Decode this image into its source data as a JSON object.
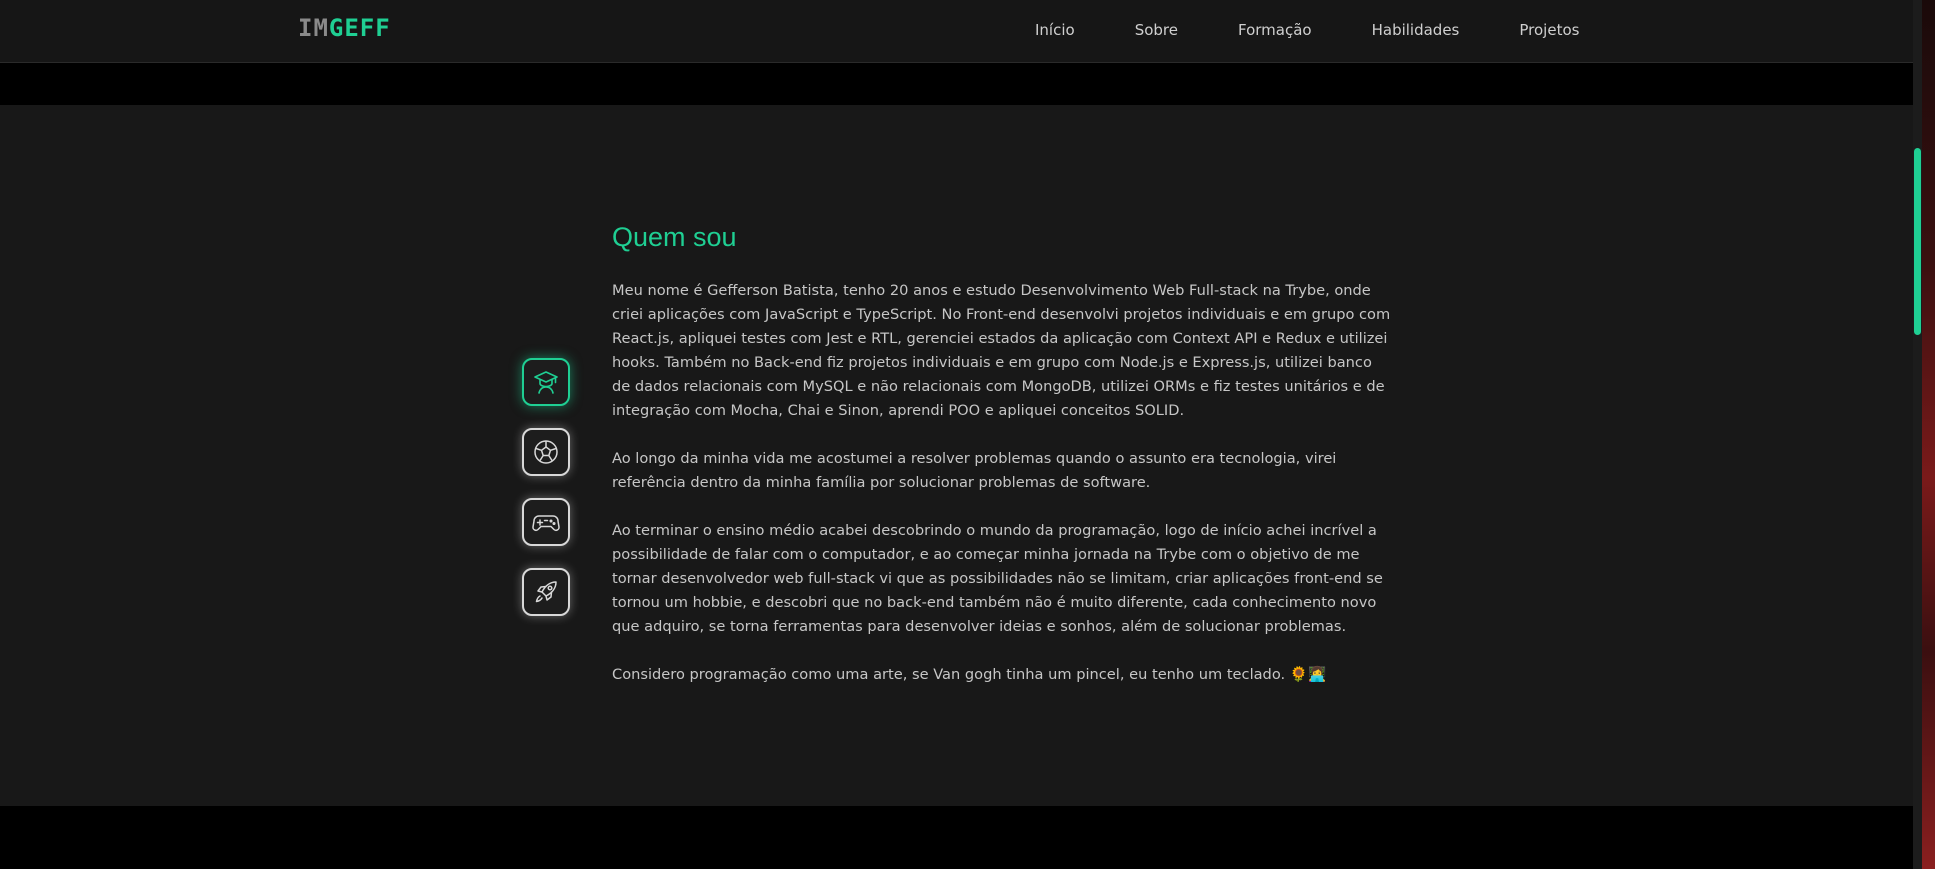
{
  "nav": {
    "logo_part1": "IM",
    "logo_part2": "GEFF",
    "links": [
      "Início",
      "Sobre",
      "Formação",
      "Habilidades",
      "Projetos"
    ]
  },
  "about": {
    "title": "Quem sou",
    "paragraphs": [
      "Meu nome é Gefferson Batista, tenho 20 anos e estudo Desenvolvimento Web Full-stack na Trybe, onde criei aplicações com JavaScript e TypeScript. No Front-end desenvolvi projetos individuais e em grupo com React.js, apliquei testes com Jest e RTL, gerenciei estados da aplicação com Context API e Redux e utilizei hooks. Também no Back-end fiz projetos individuais e em grupo com Node.js e Express.js, utilizei banco de dados relacionais com MySQL e não relacionais com MongoDB, utilizei ORMs e fiz testes unitários e de integração com Mocha, Chai e Sinon, aprendi POO e apliquei conceitos SOLID.",
      "Ao longo da minha vida me acostumei a resolver problemas quando o assunto era tecnologia, virei referência dentro da minha família por solucionar problemas de software.",
      "Ao terminar o ensino médio acabei descobrindo o mundo da programação, logo de início achei incrível a possibilidade de falar com o computador, e ao começar minha jornada na Trybe com o objetivo de me tornar desenvolvedor web full-stack vi que as possibilidades não se limitam, criar aplicações front-end se tornou um hobbie, e descobri que no back-end também não é muito diferente, cada conhecimento novo que adquiro, se torna ferramentas para desenvolver ideias e sonhos, além de solucionar problemas.",
      "Considero programação como uma arte, se Van gogh tinha um pincel, eu tenho um teclado. 🌻👩‍💻"
    ]
  },
  "icons": [
    "graduate-icon",
    "soccer-ball-icon",
    "gamepad-icon",
    "rocket-icon"
  ],
  "colors": {
    "accent": "#1fcf93",
    "background": "#181818",
    "navbar": "#161616"
  }
}
